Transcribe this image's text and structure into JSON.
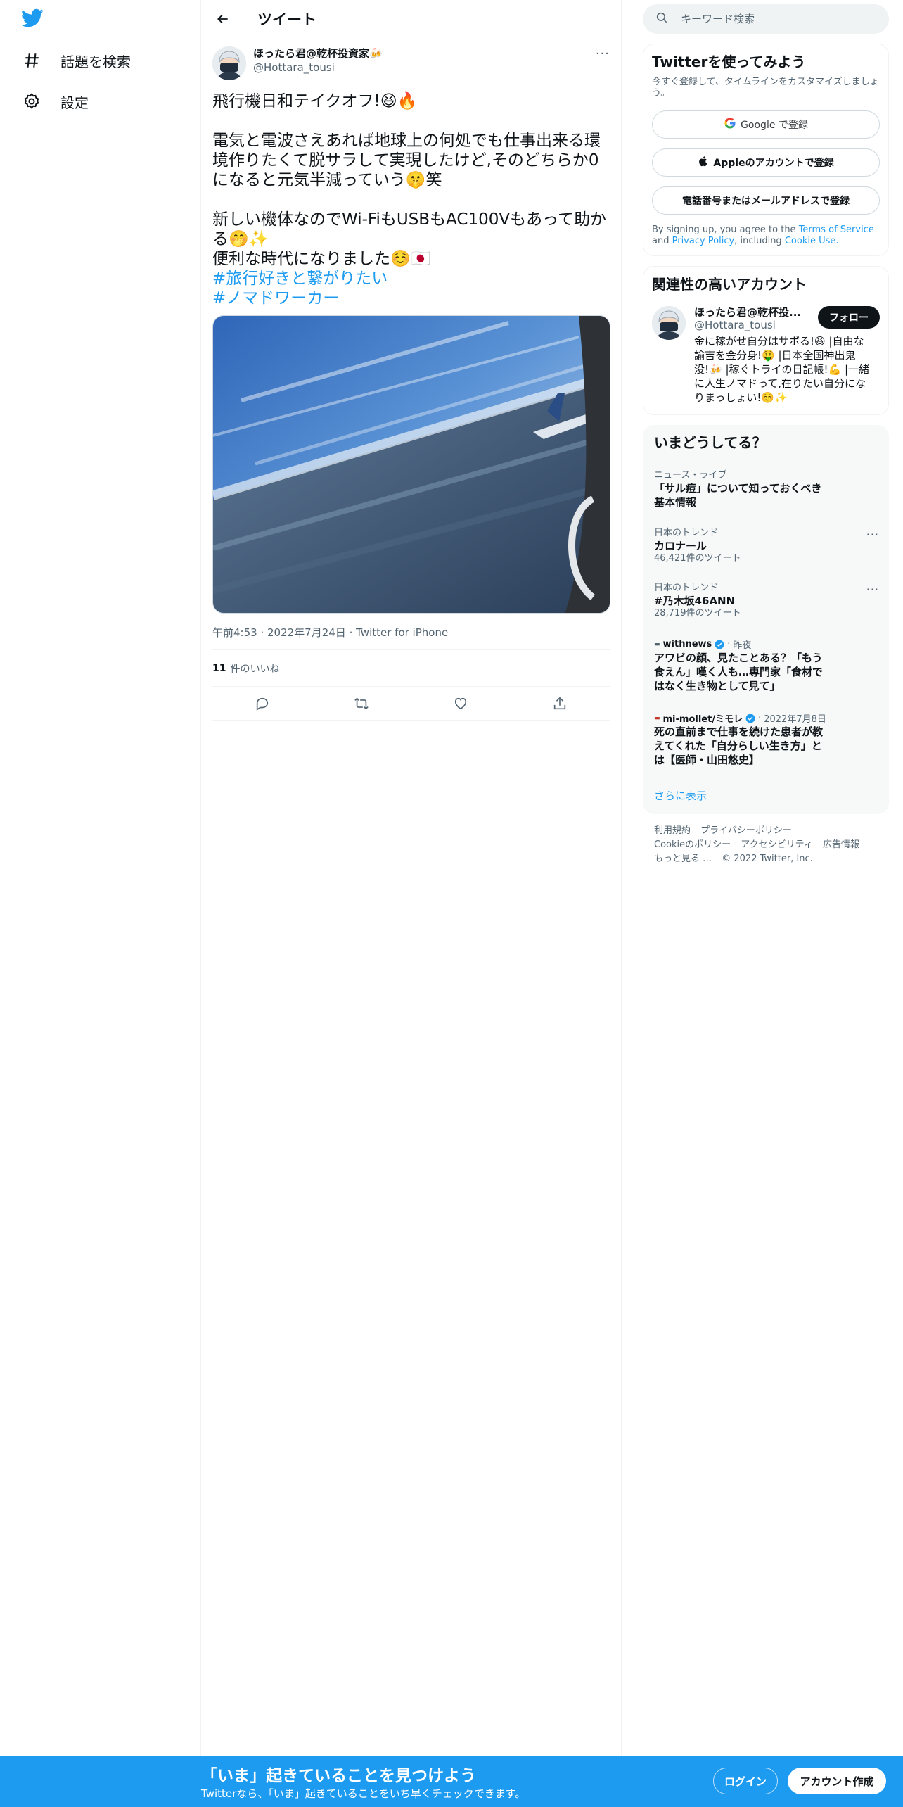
{
  "nav": {
    "explore_label": "話題を検索",
    "settings_label": "設定"
  },
  "header": {
    "title": "ツイート"
  },
  "tweet": {
    "author_name": "ほったら君@乾杯投資家🍻",
    "author_handle": "@Hottara_tousi",
    "text": "飛行機日和テイクオフ!😆🔥\n\n電気と電波さえあれば地球上の何処でも仕事出来る環境作りたくて脱サラして実現したけど,そのどちらか0になると元気半減っていう🤫笑\n\n新しい機体なのでWi-FiもUSBもAC100Vもあって助かる🤭✨\n便利な時代になりました☺️🇯🇵\n",
    "hashtags": [
      "#旅行好きと繋がりたい",
      "#ノマドワーカー"
    ],
    "time": "午前4:53",
    "date": "2022年7月24日",
    "source": "Twitter for iPhone",
    "likes_count": "11",
    "likes_label": "件のいいね"
  },
  "search": {
    "placeholder": "キーワード検索"
  },
  "signup": {
    "title": "Twitterを使ってみよう",
    "subtitle": "今すぐ登録して、タイムラインをカスタマイズしましょう。",
    "google_label": "Google で登録",
    "apple_label": "Appleのアカウントで登録",
    "phone_label": "電話番号またはメールアドレスで登録",
    "terms_prefix": "By signing up, you agree to the",
    "terms_link": "Terms of Service",
    "terms_and": "and",
    "privacy_link": "Privacy Policy",
    "terms_including": ", including",
    "cookie_link": "Cookie Use."
  },
  "related": {
    "title": "関連性の高いアカウント",
    "name": "ほったら君@乾杯投...",
    "handle": "@Hottara_tousi",
    "follow_label": "フォロー",
    "bio": "金に稼がせ自分はサボる!😆 |自由な諭吉を金分身!🤑 |日本全国神出鬼没!🍻 |稼ぐトライの日記帳!💪 |一緒に人生ノマドって,在りたい自分になりまっしょい!☺️✨"
  },
  "trends": {
    "title": "いまどうしてる？",
    "items": [
      {
        "category": "ニュース・ライブ",
        "name": "「サル痘」について知っておくべき基本情報",
        "count": ""
      },
      {
        "category": "日本のトレンド",
        "name": "カロナール",
        "count": "46,421件のツイート"
      },
      {
        "category": "日本のトレンド",
        "name": "#乃木坂46ANN",
        "count": "28,719件のツイート"
      }
    ],
    "news": [
      {
        "source": "withnews",
        "time": "昨夜",
        "headline": "アワビの顔、見たことある？「もう食えん」嘆く人も…専門家「食材ではなく生き物として見て」"
      },
      {
        "source": "mi-mollet/ミモレ",
        "time": "2022年7月8日",
        "headline": "死の直前まで仕事を続けた患者が教えてくれた「自分らしい生き方」とは【医師・山田悠史】"
      }
    ],
    "show_more": "さらに表示"
  },
  "footer": {
    "terms": "利用規約",
    "privacy": "プライバシーポリシー",
    "cookie": "Cookieのポリシー",
    "accessibility": "アクセシビリティ",
    "ads": "広告情報",
    "more": "もっと見る …",
    "copyright": "© 2022 Twitter, Inc."
  },
  "bottom_bar": {
    "title": "「いま」起きていることを見つけよう",
    "subtitle": "Twitterなら、「いま」起きていることをいち早くチェックできます。",
    "login": "ログイン",
    "signup": "アカウント作成"
  },
  "colors": {
    "accent": "#1d9bf0",
    "text": "#0f1419",
    "muted": "#536471"
  }
}
